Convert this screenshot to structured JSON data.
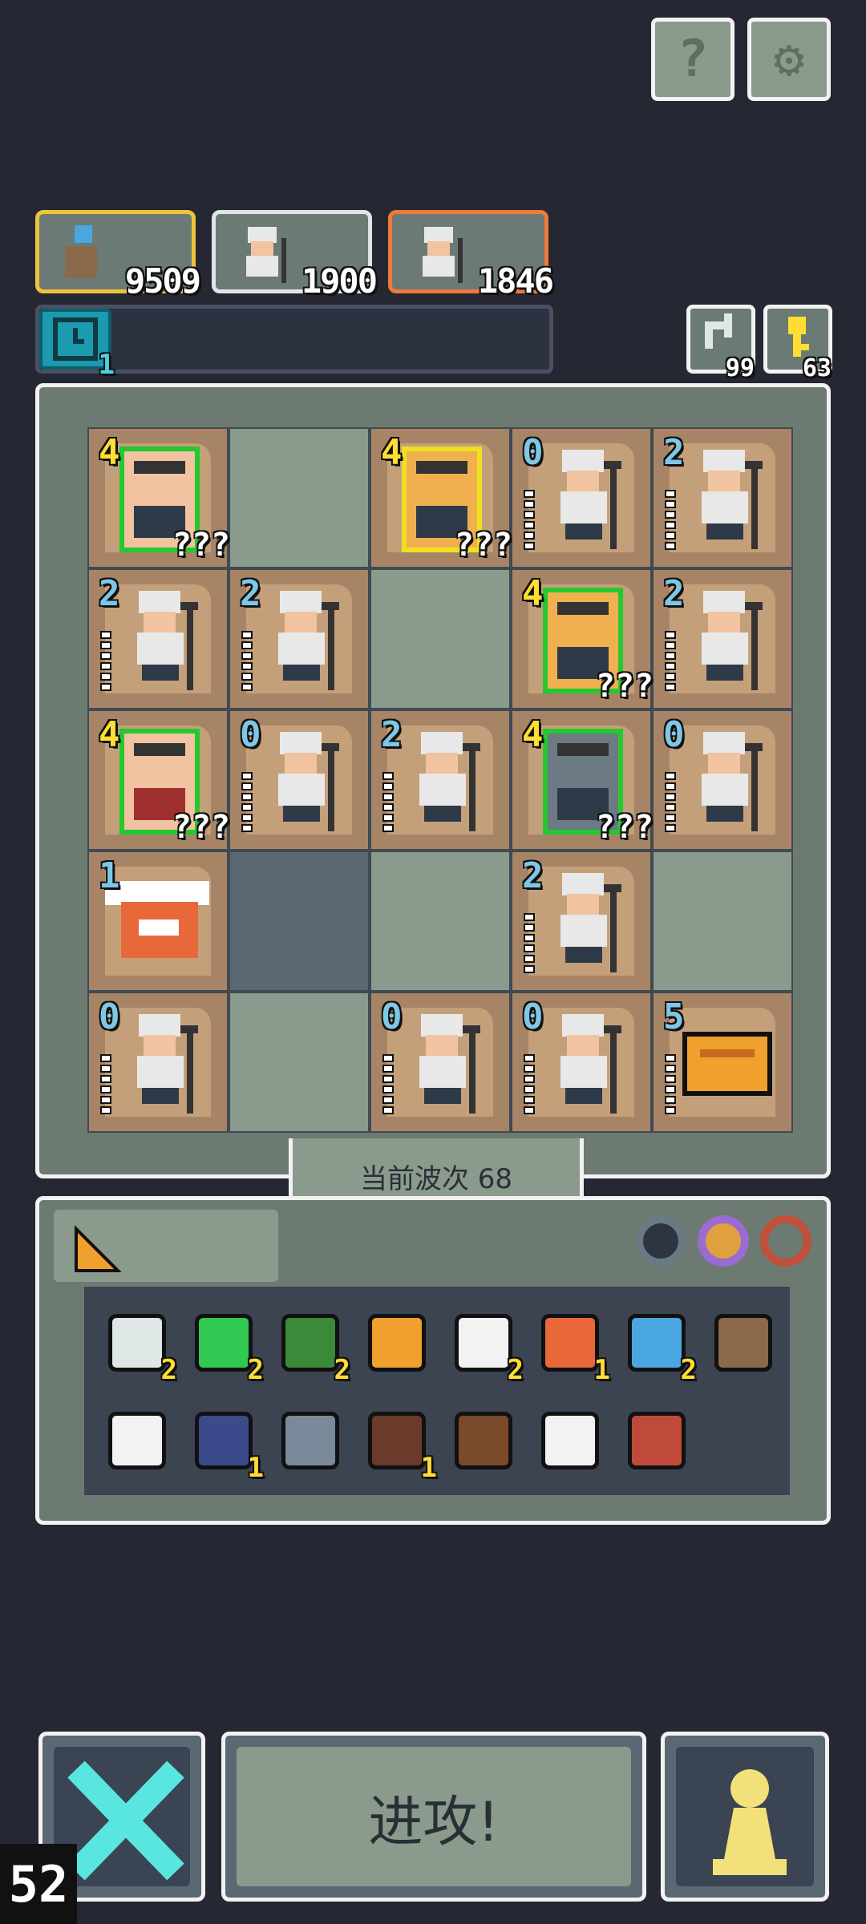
{
  "top_buttons": {
    "help_glyph": "?",
    "settings_glyph": "⚙"
  },
  "heroes": [
    {
      "value": "9509",
      "border": "#f0c33c"
    },
    {
      "value": "1900",
      "border": "#dfe6e6"
    },
    {
      "value": "1846",
      "border": "#ef7a3c"
    }
  ],
  "status": {
    "timer_count": "1"
  },
  "resources": {
    "refresh_count": "99",
    "key_count": "63"
  },
  "wave": {
    "text": "当前波次 68"
  },
  "board": {
    "cells": [
      {
        "level": "4",
        "tier": "gold",
        "unknown": "???",
        "kind": "pirate"
      },
      {
        "level": "4",
        "tier": "gold",
        "unknown": "???",
        "kind": "golden-knight"
      },
      {
        "level": "0",
        "tier": "blue",
        "kind": "sage"
      },
      {
        "level": "2",
        "tier": "blue",
        "kind": "sage"
      },
      {
        "level": "2",
        "tier": "blue",
        "kind": "sage"
      },
      {
        "level": "2",
        "tier": "blue",
        "kind": "sage"
      },
      {
        "level": "4",
        "tier": "gold",
        "unknown": "???",
        "kind": "golem"
      },
      {
        "level": "2",
        "tier": "blue",
        "kind": "sage"
      },
      {
        "level": "4",
        "tier": "gold",
        "unknown": "???",
        "kind": "viking"
      },
      {
        "level": "0",
        "tier": "blue",
        "kind": "sage"
      },
      {
        "level": "2",
        "tier": "blue",
        "kind": "sage"
      },
      {
        "level": "4",
        "tier": "gold",
        "unknown": "???",
        "kind": "armored-guard"
      },
      {
        "level": "0",
        "tier": "blue",
        "kind": "sage"
      },
      {
        "level": "1",
        "tier": "blue",
        "kind": "winged-beast"
      },
      {
        "level": "2",
        "tier": "blue",
        "kind": "sage"
      },
      {
        "level": "0",
        "tier": "blue",
        "kind": "sage"
      },
      {
        "level": "0",
        "tier": "blue",
        "kind": "sage"
      },
      {
        "level": "0",
        "tier": "blue",
        "kind": "sage"
      },
      {
        "level": "5",
        "tier": "blue",
        "kind": "treasure-pot"
      }
    ]
  },
  "inventory": {
    "items": [
      {
        "name": "scroll-icon",
        "count": "2"
      },
      {
        "name": "emerald-icon",
        "count": "2"
      },
      {
        "name": "hood-icon",
        "count": "2"
      },
      {
        "name": "cookie-icon",
        "count": ""
      },
      {
        "name": "cloud-icon",
        "count": "2"
      },
      {
        "name": "whip-icon",
        "count": "1"
      },
      {
        "name": "crystal-icon",
        "count": "2"
      },
      {
        "name": "feather-pouch-icon",
        "count": ""
      },
      {
        "name": "potion-icon",
        "count": ""
      },
      {
        "name": "tower-icon",
        "count": "1"
      },
      {
        "name": "sword-icon",
        "count": ""
      },
      {
        "name": "hammer-icon",
        "count": "1"
      },
      {
        "name": "spiked-chest-icon",
        "count": ""
      },
      {
        "name": "ice-crystal-icon",
        "count": ""
      },
      {
        "name": "lantern-icon",
        "count": ""
      }
    ]
  },
  "bottom": {
    "attack_label": "进攻!",
    "counter": "52"
  },
  "colors": {
    "bg": "#252833",
    "panel": "#6c7a72",
    "tile": "#8a9a8c",
    "unit": "#a88466"
  }
}
